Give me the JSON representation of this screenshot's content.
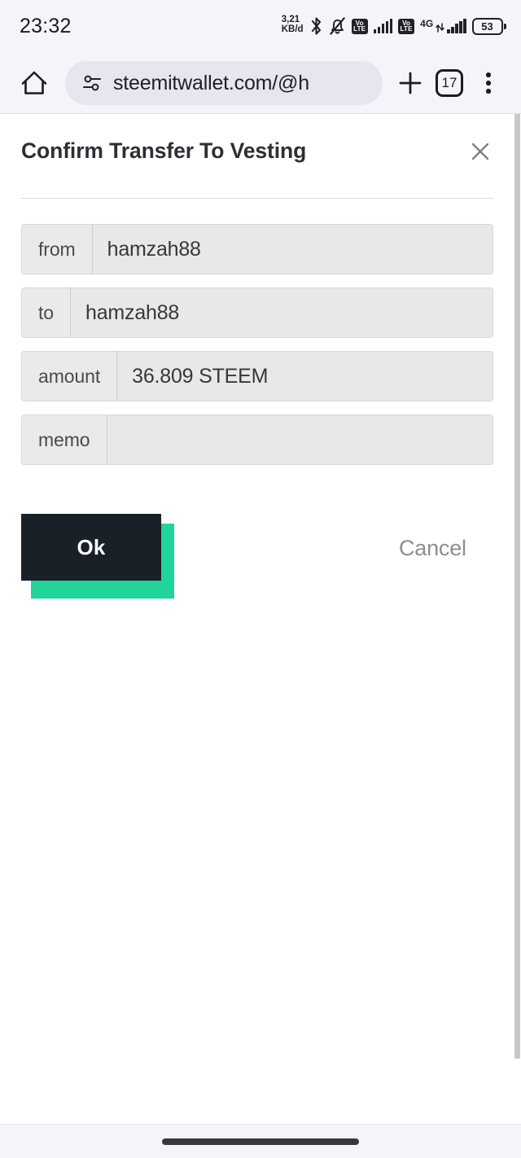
{
  "status_bar": {
    "clock": "23:32",
    "data_rate_value": "3,21",
    "data_rate_unit": "KB/d",
    "bluetooth_icon": "bluetooth-icon",
    "mute_icon": "bell-muted-icon",
    "volte_label_1": "Vo",
    "volte_sub_1": "LTE",
    "volte_label_2": "Vo",
    "volte_sub_2": "LTE",
    "network_label": "4G",
    "battery_percent": "53"
  },
  "browser": {
    "home_icon": "home-icon",
    "site_settings_icon": "tune-icon",
    "url": "steemitwallet.com/@h",
    "new_tab_icon": "plus-icon",
    "tab_count": "17",
    "menu_icon": "more-vertical-icon"
  },
  "dialog": {
    "title": "Confirm Transfer To Vesting",
    "close_icon": "close-icon",
    "rows": [
      {
        "label": "from",
        "value": "hamzah88"
      },
      {
        "label": "to",
        "value": "hamzah88"
      },
      {
        "label": "amount",
        "value": "36.809 STEEM"
      },
      {
        "label": "memo",
        "value": ""
      }
    ],
    "ok_label": "Ok",
    "cancel_label": "Cancel"
  },
  "colors": {
    "accent_green": "#21d49a",
    "button_dark": "#192028",
    "chrome_bg": "#f5f4fb",
    "omnibox_bg": "#e6e5f0",
    "field_bg": "#e8e8e8",
    "label_bg": "#eaeaea"
  }
}
